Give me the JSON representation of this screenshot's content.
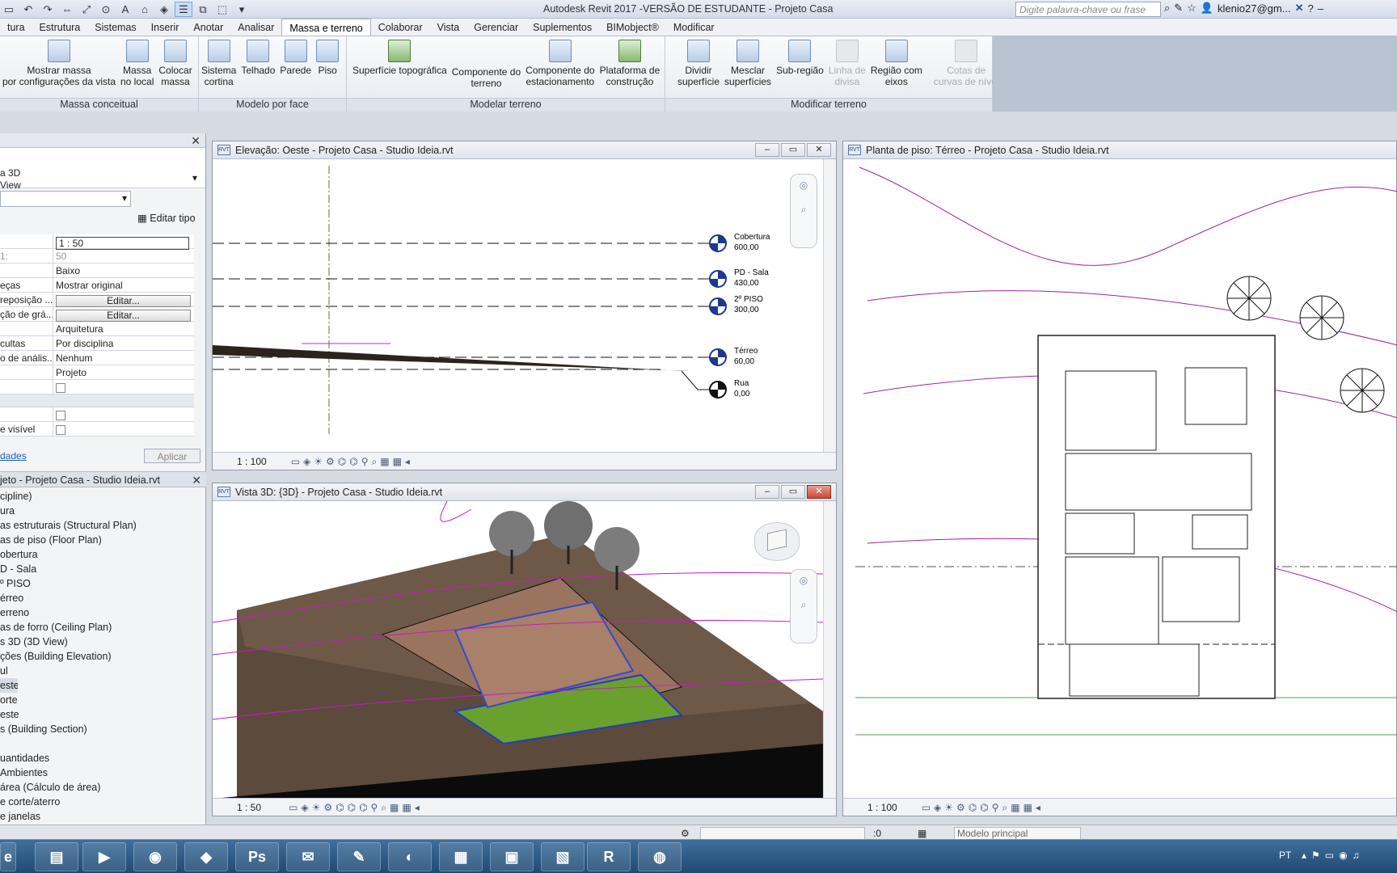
{
  "app": {
    "title": "Autodesk Revit 2017 -VERSÃO DE ESTUDANTE -    Projeto Casa",
    "search_placeholder": "Digite palavra-chave ou frase",
    "user": "klenio27@gm..."
  },
  "menu_tabs": [
    "tura",
    "Estrutura",
    "Sistemas",
    "Inserir",
    "Anotar",
    "Analisar",
    "Massa e terreno",
    "Colaborar",
    "Vista",
    "Gerenciar",
    "Suplementos",
    "BIMobject®",
    "Modificar"
  ],
  "ribbon": {
    "massa_conceitual": {
      "label": "Massa conceitual",
      "buttons": [
        "Mostrar massa\npor configurações da vista",
        "Massa\nno local",
        "Colocar\nmassa"
      ]
    },
    "modelo_por_face": {
      "label": "Modelo por face",
      "buttons": [
        "Sistema\ncortina",
        "Telhado",
        "Parede",
        "Piso"
      ]
    },
    "modelar_terreno": {
      "label": "Modelar terreno",
      "buttons": [
        "Superfície topográfica",
        "Componente do\nterreno",
        "Componente do\nestacionamento",
        "Plataforma de\nconstrução"
      ]
    },
    "modificar_terreno": {
      "label": "Modificar terreno",
      "buttons": [
        "Dividir\nsuperfície",
        "Mesclar\nsuperfícies",
        "Sub-região",
        "Linha de\ndivisa",
        "Região com\neixos",
        "Cotas de\ncurvas de nível"
      ]
    }
  },
  "properties": {
    "type_line1": "a 3D",
    "type_line2": "View",
    "edit_type": "Editar tipo",
    "rows": [
      {
        "k": "",
        "v": "1 : 50"
      },
      {
        "k": "1:",
        "v": "50"
      },
      {
        "k": "",
        "v": "Baixo"
      },
      {
        "k": "eças",
        "v": "Mostrar original"
      },
      {
        "k": "reposição ...",
        "v": "Editar..."
      },
      {
        "k": "ção de grá...",
        "v": "Editar..."
      },
      {
        "k": "",
        "v": "Arquitetura"
      },
      {
        "k": "cultas",
        "v": "Por disciplina"
      },
      {
        "k": "o de anális...",
        "v": "Nenhum"
      },
      {
        "k": "",
        "v": "Projeto"
      }
    ],
    "visivel": "e visível",
    "link": "dades",
    "apply": "Aplicar"
  },
  "browser": {
    "title": "jeto - Projeto Casa - Studio Ideia.rvt",
    "items": [
      "cipline)",
      "ura",
      "as estruturais (Structural Plan)",
      "as de piso (Floor Plan)",
      "obertura",
      "D - Sala",
      "º PISO",
      "érreo",
      "erreno",
      "as de forro (Ceiling Plan)",
      "s 3D (3D View)",
      "ções (Building Elevation)",
      "ul",
      "este",
      "orte",
      "este",
      "s (Building Section)",
      "",
      "uantidades",
      "Ambientes",
      "área (Cálculo de área)",
      "e corte/aterro",
      "e janelas"
    ]
  },
  "views": {
    "elev": {
      "title": "Elevação: Oeste - Projeto Casa - Studio Ideia.rvt",
      "scale": "1 : 100"
    },
    "v3d": {
      "title": "Vista 3D: {3D} - Projeto Casa - Studio Ideia.rvt",
      "scale": "1 : 50"
    },
    "plan": {
      "title": "Planta de piso: Térreo - Projeto Casa - Studio Ideia.rvt",
      "scale": "1 : 100"
    }
  },
  "levels": [
    {
      "name": "Cobertura",
      "value": "600,00"
    },
    {
      "name": "PD - Sala",
      "value": "430,00"
    },
    {
      "name": "2º PISO",
      "value": "300,00"
    },
    {
      "name": "Térreo",
      "value": "60,00"
    },
    {
      "name": "Rua",
      "value": "0,00"
    }
  ],
  "status": {
    "zero": ":0",
    "model": "Modelo principal"
  },
  "taskbar": {
    "lang": "PT"
  }
}
